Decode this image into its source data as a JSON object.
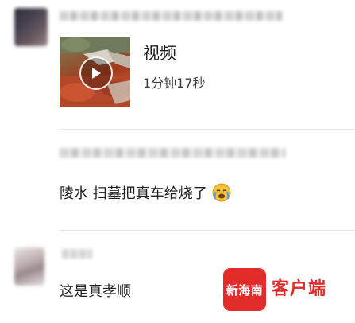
{
  "comment1": {
    "video": {
      "title": "视频",
      "duration": "1分钟17秒"
    }
  },
  "comment2": {
    "text": "陵水 扫墓把真车给烧了"
  },
  "comment3": {
    "text": "这是真孝顺"
  },
  "watermark": {
    "logo_text": "新海南",
    "label": "客户端"
  },
  "colors": {
    "accent": "#e22b2b",
    "divider": "#e8e8e8"
  },
  "icons": [
    "play-icon",
    "crying-emoji-icon"
  ]
}
